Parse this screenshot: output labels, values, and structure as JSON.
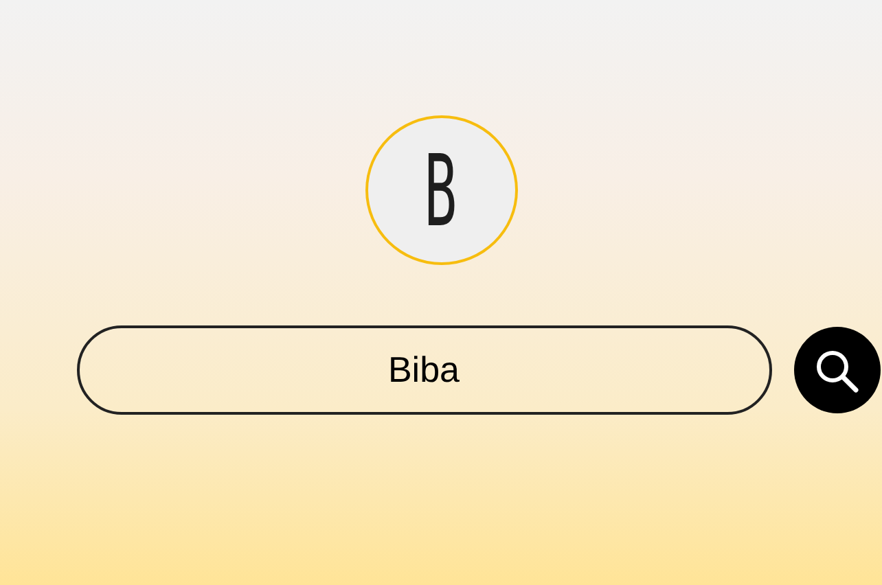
{
  "logo": {
    "letter": "B"
  },
  "search": {
    "value": "Biba"
  }
}
